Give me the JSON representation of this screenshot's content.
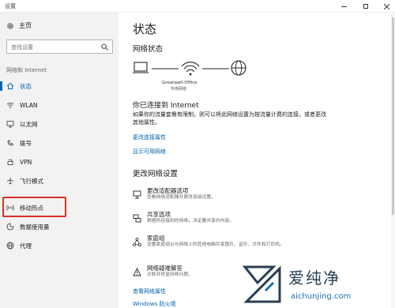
{
  "window": {
    "title": "设置"
  },
  "sidebar": {
    "home_label": "主页",
    "search_placeholder": "查找设置",
    "section_label": "网络和 Internet",
    "items": [
      {
        "label": "状态",
        "icon": "home-icon",
        "selected": true
      },
      {
        "label": "WLAN",
        "icon": "wifi-icon"
      },
      {
        "label": "以太网",
        "icon": "ethernet-icon"
      },
      {
        "label": "拨号",
        "icon": "phone-icon"
      },
      {
        "label": "VPN",
        "icon": "vpn-icon"
      },
      {
        "label": "飞行模式",
        "icon": "airplane-icon"
      },
      {
        "label": "移动热点",
        "icon": "hotspot-icon"
      },
      {
        "label": "数据使用量",
        "icon": "data-usage-icon"
      },
      {
        "label": "代理",
        "icon": "globe-icon"
      }
    ]
  },
  "main": {
    "title": "状态",
    "network_status_heading": "网络状态",
    "network_name": "Greatwall-Office",
    "network_type": "专用网络",
    "connected_heading": "你已连接到 Internet",
    "connected_desc": "如果你的流量套餐有限制，则可以将此网络设置为按流量计费的连接，或者更改其他属性。",
    "link_change_properties": "更改连接属性",
    "link_show_available": "显示可用网络",
    "change_settings_heading": "更改网络设置",
    "settings": [
      {
        "title": "更改适配器选项",
        "desc": "查看网络适配器并更改连接设置。",
        "icon": "adapter-icon"
      },
      {
        "title": "共享选项",
        "desc": "根据所连接到的网络，决定要共享的内容。",
        "icon": "sharing-icon"
      },
      {
        "title": "家庭组",
        "desc": "设置家庭组以与网络上的其他电脑共享图片、音乐、文件和打印机。",
        "icon": "homegroup-icon"
      },
      {
        "title": "网络疑难解答",
        "desc": "诊断并修复网络问题。",
        "icon": "warning-icon"
      }
    ],
    "link_view_properties": "查看网络属性",
    "link_firewall": "Windows 防火墙"
  },
  "watermark": {
    "text": "爱纯净",
    "url": "aichunjing.com"
  },
  "colors": {
    "accent": "#0063b1",
    "highlight": "#d93025"
  }
}
